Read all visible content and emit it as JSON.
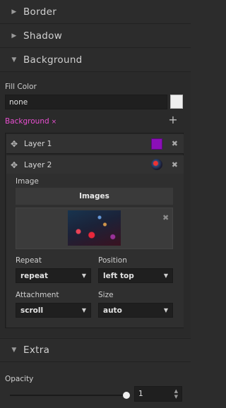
{
  "sections": {
    "border": "Border",
    "shadow": "Shadow",
    "background": "Background",
    "extra": "Extra"
  },
  "fill": {
    "label": "Fill Color",
    "value": "none",
    "swatch_color": "#efefef"
  },
  "background": {
    "tag_label": "Background",
    "tag_remove": "×",
    "add_icon": "+"
  },
  "layers": [
    {
      "name": "Layer 1",
      "swatch_color": "#8b0fb8"
    },
    {
      "name": "Layer 2"
    }
  ],
  "layer2": {
    "image_label": "Image",
    "images_button": "Images",
    "repeat_label": "Repeat",
    "repeat_value": "repeat",
    "position_label": "Position",
    "position_value": "left top",
    "attachment_label": "Attachment",
    "attachment_value": "scroll",
    "size_label": "Size",
    "size_value": "auto"
  },
  "opacity": {
    "label": "Opacity",
    "value": "1",
    "slider_level": 1
  },
  "colors": {
    "accent_pink": "#e94fd1",
    "panel_bg": "#2c2c2c"
  }
}
